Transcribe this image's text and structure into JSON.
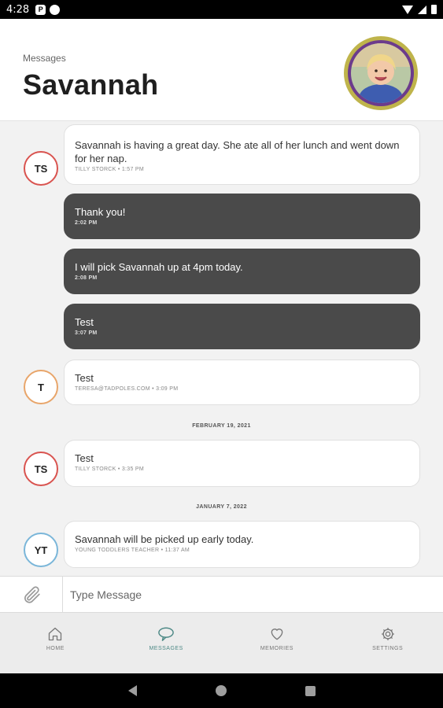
{
  "status_bar": {
    "time": "4:28",
    "app_icon": "P"
  },
  "header": {
    "breadcrumb": "Messages",
    "title": "Savannah"
  },
  "messages": [
    {
      "initials": "TS",
      "ring": "#d9534f",
      "text": "Savannah is having a great day. She ate all of her lunch and went down for her nap.",
      "meta": "TILLY STORCK • 1:57 PM"
    },
    {
      "text": "Thank you!",
      "meta": "2:02 PM"
    },
    {
      "text": "I will pick Savannah up at 4pm today.",
      "meta": "2:08 PM"
    },
    {
      "text": "Test",
      "meta": "3:07 PM"
    },
    {
      "initials": "T",
      "ring": "#e8a56a",
      "text": "Test",
      "meta": "TERESA@TADPOLES.COM • 3:09 PM"
    },
    {
      "initials": "TS",
      "ring": "#d9534f",
      "text": "Test",
      "meta": "TILLY STORCK • 3:35 PM"
    },
    {
      "initials": "YT",
      "ring": "#7ab6d9",
      "text": "Savannah will be picked up early today.",
      "meta": "YOUNG TODDLERS TEACHER • 11:37 AM"
    }
  ],
  "date_separators": [
    "FEBRUARY 19, 2021",
    "JANUARY 7, 2022"
  ],
  "composer": {
    "placeholder": "Type Message"
  },
  "tabs": [
    {
      "label": "HOME",
      "icon": "home-icon"
    },
    {
      "label": "MESSAGES",
      "icon": "chat-bubble-icon",
      "active": true
    },
    {
      "label": "MEMORIES",
      "icon": "heart-icon"
    },
    {
      "label": "SETTINGS",
      "icon": "gear-icon"
    }
  ],
  "colors": {
    "accent": "#4f8a87",
    "sent_bubble": "#4a4a4a",
    "avatar_ring_outer": "#bfb44b",
    "avatar_ring_inner": "#6c3b8c"
  }
}
